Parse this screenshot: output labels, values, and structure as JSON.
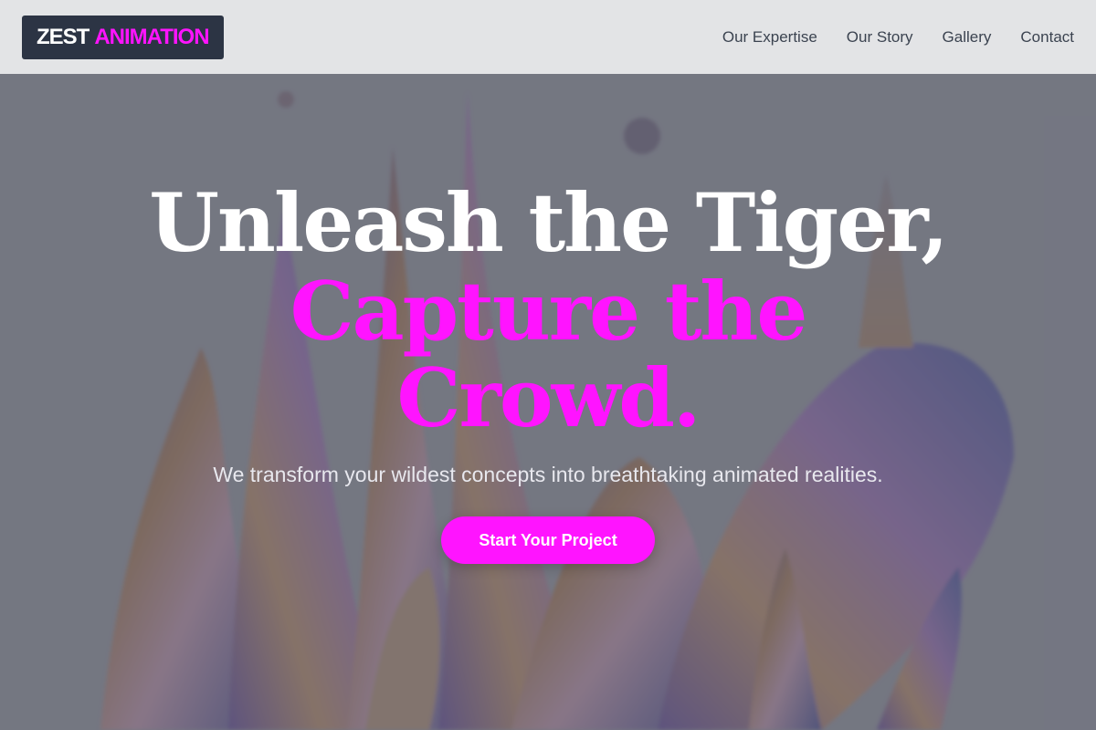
{
  "brand": {
    "name_part1": "ZEST",
    "name_part2": "ANIMATION"
  },
  "nav": {
    "items": [
      "Our Expertise",
      "Our Story",
      "Gallery",
      "Contact"
    ]
  },
  "hero": {
    "headline_line1": "Unleash the Tiger,",
    "headline_line2": "Capture the",
    "headline_line3": "Crowd.",
    "subtitle": "We transform your wildest concepts into breathtaking animated realities.",
    "cta_label": "Start Your Project"
  },
  "colors": {
    "accent": "#ff14ff",
    "header_bg": "#e3e4e6",
    "logo_bg": "#2c3444",
    "overlay": "#5f626e"
  }
}
